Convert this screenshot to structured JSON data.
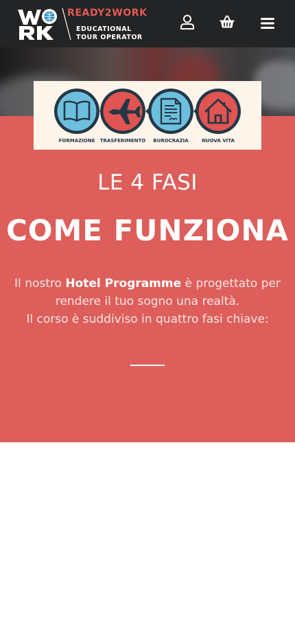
{
  "header": {
    "brand": "READY2WORK",
    "tagline_line1": "EDUCATIONAL",
    "tagline_line2": "TOUR OPERATOR",
    "icons": {
      "account": "user-icon",
      "cart": "basket-icon",
      "menu": "hamburger-menu-icon"
    }
  },
  "steps": [
    {
      "label": "FORMAZIONE",
      "icon": "book-icon"
    },
    {
      "label": "TRASFERIMENTO",
      "icon": "airplane-icon"
    },
    {
      "label": "BUROCRAZIA",
      "icon": "document-icon"
    },
    {
      "label": "NUOVA VITA",
      "icon": "house-icon"
    }
  ],
  "section": {
    "eyebrow": "LE 4 FASI",
    "title": "COME FUNZIONA",
    "desc_prefix": "Il nostro ",
    "desc_bold": "Hotel Programme",
    "desc_suffix": " è progettato per rendere il tuo sogno una realtà.",
    "desc_line2": "Il corso è suddiviso in quattro fasi chiave:"
  },
  "colors": {
    "header_bg": "#232425",
    "brand_red": "#e25a56",
    "section_red": "#dd5e5a",
    "step_blue": "#6cc0de",
    "step_red": "#e05451",
    "step_dark": "#243746",
    "card_bg": "#fdf4ea"
  }
}
